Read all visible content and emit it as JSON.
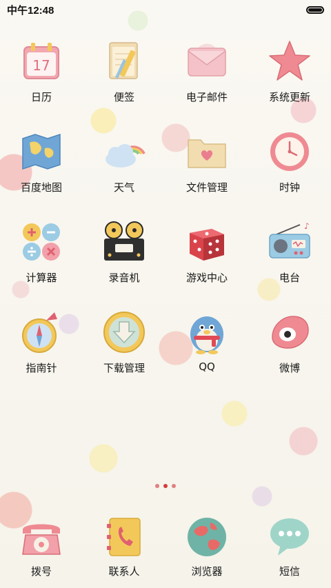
{
  "status_bar": {
    "time": "中午12:48",
    "battery_icon": "battery-full-icon"
  },
  "apps": [
    {
      "id": "calendar",
      "label": "日历",
      "icon": "calendar-icon",
      "badge": "17"
    },
    {
      "id": "notes",
      "label": "便签",
      "icon": "notepad-icon"
    },
    {
      "id": "email",
      "label": "电子邮件",
      "icon": "envelope-icon"
    },
    {
      "id": "system-update",
      "label": "系统更新",
      "icon": "star-icon"
    },
    {
      "id": "baidu-map",
      "label": "百度地图",
      "icon": "map-icon"
    },
    {
      "id": "weather",
      "label": "天气",
      "icon": "cloud-rainbow-icon"
    },
    {
      "id": "file-manager",
      "label": "文件管理",
      "icon": "folder-heart-icon"
    },
    {
      "id": "clock",
      "label": "时钟",
      "icon": "clock-icon"
    },
    {
      "id": "calculator",
      "label": "计算器",
      "icon": "calculator-icon"
    },
    {
      "id": "recorder",
      "label": "录音机",
      "icon": "tape-recorder-icon"
    },
    {
      "id": "game-center",
      "label": "游戏中心",
      "icon": "dice-icon"
    },
    {
      "id": "radio",
      "label": "电台",
      "icon": "radio-icon"
    },
    {
      "id": "compass",
      "label": "指南针",
      "icon": "compass-icon"
    },
    {
      "id": "download-manager",
      "label": "下载管理",
      "icon": "download-arrow-icon"
    },
    {
      "id": "qq",
      "label": "QQ",
      "icon": "penguin-icon"
    },
    {
      "id": "weibo",
      "label": "微博",
      "icon": "weibo-eye-icon"
    }
  ],
  "dock": [
    {
      "id": "dialer",
      "label": "拨号",
      "icon": "telephone-icon"
    },
    {
      "id": "contacts",
      "label": "联系人",
      "icon": "contacts-phone-icon"
    },
    {
      "id": "browser",
      "label": "浏览器",
      "icon": "globe-icon"
    },
    {
      "id": "sms",
      "label": "短信",
      "icon": "speech-bubble-icon"
    }
  ],
  "page_indicator": {
    "pages": 3,
    "current": 2
  }
}
